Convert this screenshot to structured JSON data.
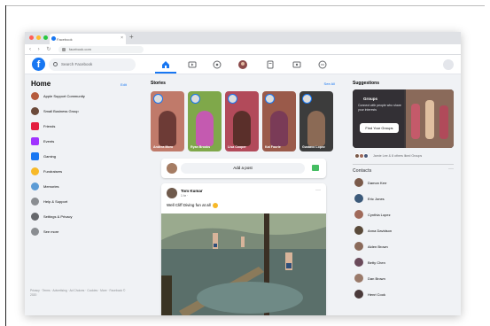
{
  "browser": {
    "tab_title": "Facebook",
    "url": "facebook.com",
    "new_tab": "+",
    "close_tab": "×",
    "nav_buttons": "‹ › ↻"
  },
  "header": {
    "logo": "f",
    "search_placeholder": "Search Facebook"
  },
  "sidebar": {
    "title": "Home",
    "edit_label": "Edit",
    "items": [
      {
        "label": "Apple Support Community",
        "icon": "community-icon",
        "color": "#b45a3c"
      },
      {
        "label": "Small Business Group",
        "icon": "group-icon",
        "color": "#6b4a3a"
      },
      {
        "label": "Friends",
        "icon": "friends-icon",
        "color": "#e41e3f"
      },
      {
        "label": "Events",
        "icon": "events-icon",
        "color": "#a033ff"
      },
      {
        "label": "Gaming",
        "icon": "gaming-icon",
        "color": "#1877f2"
      },
      {
        "label": "Fundraisers",
        "icon": "fundraiser-icon",
        "color": "#f7b928"
      },
      {
        "label": "Memories",
        "icon": "memories-icon",
        "color": "#5b9bd5"
      },
      {
        "label": "Help & Support",
        "icon": "help-icon",
        "color": "#8a8d91"
      },
      {
        "label": "Settings & Privacy",
        "icon": "settings-icon",
        "color": "#65676b"
      },
      {
        "label": "See more",
        "icon": "see-more-icon",
        "color": "#8a8d91"
      }
    ],
    "footer": "Privacy · Terms · Advertising · Ad Choices · Cookies · More · Facebook © 2020"
  },
  "stories": {
    "title": "Stories",
    "see_all": "See All",
    "items": [
      {
        "name": "Andrea Moro",
        "bg": "#c07a6a",
        "fig": "#6d3b36"
      },
      {
        "name": "Ryan Brooks",
        "bg": "#7fa84a",
        "fig": "#c45ab0"
      },
      {
        "name": "Lisa Cooper",
        "bg": "#b24a5a",
        "fig": "#5a2f2a"
      },
      {
        "name": "Kat Fourie",
        "bg": "#9a5a4a",
        "fig": "#7a3b57"
      },
      {
        "name": "Gustavo Lopez",
        "bg": "#3c3c3c",
        "fig": "#8b6a55"
      }
    ]
  },
  "composer": {
    "placeholder": "Add a post"
  },
  "post": {
    "author": "Tom Kumar",
    "time": "1 hr · ",
    "text": "Well Cliff Diving fun at all",
    "more": "···"
  },
  "suggestions": {
    "title": "Suggestions",
    "card_label": "Groups",
    "card_tagline": "Connect with people who share your interests",
    "button": "Find Your Groups",
    "mutual": "Jamie Lee & 8 others liked Groups"
  },
  "contacts": {
    "title": "Contacts",
    "more": "···",
    "people": [
      {
        "name": "Damon Kerr",
        "color": "#7a5a4a"
      },
      {
        "name": "Eric Jones",
        "color": "#3c5a7a"
      },
      {
        "name": "Cynthia Lopez",
        "color": "#a06a5a"
      },
      {
        "name": "Anna Davidson",
        "color": "#5a4a3a"
      },
      {
        "name": "Aiden Brown",
        "color": "#8a6a5a"
      },
      {
        "name": "Betty Chen",
        "color": "#6a4a5a"
      },
      {
        "name": "Dan Brown",
        "color": "#9a7a6a"
      },
      {
        "name": "Henri Cook",
        "color": "#4a3a3a"
      }
    ]
  },
  "colors": {
    "brand": "#1877f2",
    "background": "#f0f2f5"
  }
}
